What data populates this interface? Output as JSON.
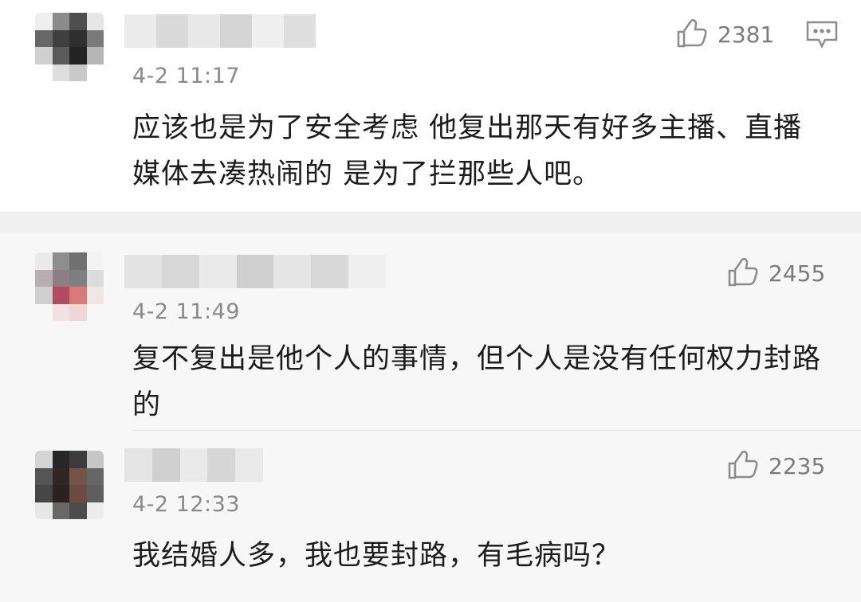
{
  "comments": [
    {
      "time": "4-2 11:17",
      "likes": "2381",
      "text": "应该也是为了安全考虑 他复出那天有好多主播、直播媒体去凑热闹的 是为了拦那些人吧。",
      "has_reply_icon": true
    },
    {
      "time": "4-2 11:49",
      "likes": "2455",
      "text": "复不复出是他个人的事情，但个人是没有任何权力封路的"
    },
    {
      "time": "4-2 12:33",
      "likes": "2235",
      "text": "我结婚人多，我也要封路，有毛病吗？"
    }
  ],
  "icons": {
    "like": "thumbs-up-icon",
    "reply": "comment-icon",
    "avatar": "blurred-avatar",
    "username": "blurred-username"
  },
  "colors": {
    "top_background": "#ffffff",
    "reply_background": "#f7f7f7",
    "separator": "#f0f0f0",
    "meta_text": "#8a8a8a",
    "body_text": "#1c1c1c"
  }
}
